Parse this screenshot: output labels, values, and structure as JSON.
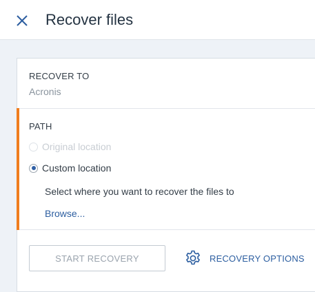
{
  "header": {
    "title": "Recover files",
    "close_icon": "close-icon"
  },
  "recover_to": {
    "label": "RECOVER TO",
    "value": "Acronis"
  },
  "path": {
    "label": "PATH",
    "options": [
      {
        "label": "Original location",
        "selected": false,
        "disabled": true
      },
      {
        "label": "Custom location",
        "selected": true,
        "disabled": false
      }
    ],
    "instruction": "Select where you want to recover the files to",
    "browse_label": "Browse..."
  },
  "actions": {
    "start_label": "START RECOVERY",
    "options_label": "RECOVERY OPTIONS",
    "options_icon": "gear-icon"
  },
  "colors": {
    "accent": "#f07d1e",
    "link": "#2c5ea0",
    "radio_selected": "#2f5fa5",
    "background": "#eef2f7"
  }
}
